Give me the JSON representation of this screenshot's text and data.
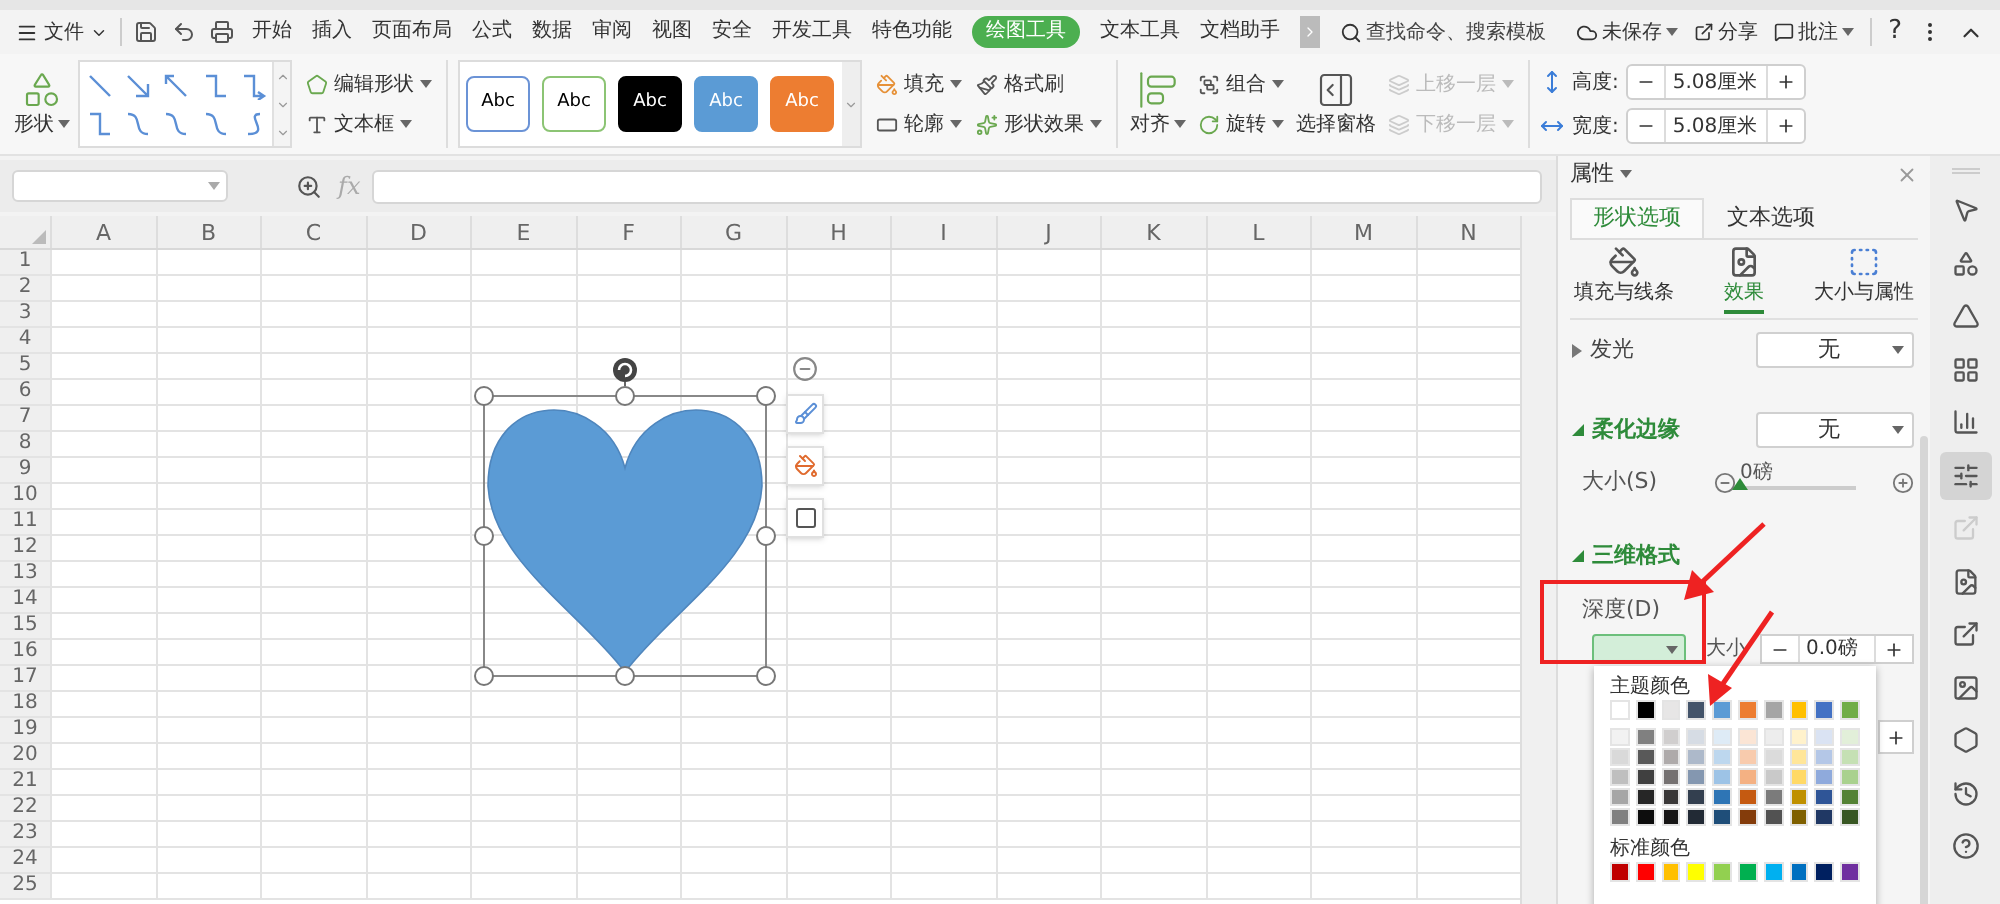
{
  "menu": {
    "file_label": "文件",
    "tabs": [
      {
        "label": "开始",
        "selected": false
      },
      {
        "label": "插入",
        "selected": false
      },
      {
        "label": "页面布局",
        "selected": false
      },
      {
        "label": "公式",
        "selected": false
      },
      {
        "label": "数据",
        "selected": false
      },
      {
        "label": "审阅",
        "selected": false
      },
      {
        "label": "视图",
        "selected": false
      },
      {
        "label": "安全",
        "selected": false
      },
      {
        "label": "开发工具",
        "selected": false
      },
      {
        "label": "特色功能",
        "selected": false
      },
      {
        "label": "绘图工具",
        "selected": true
      },
      {
        "label": "文本工具",
        "selected": false
      },
      {
        "label": "文档助手",
        "selected": false
      }
    ],
    "search": {
      "placeholder": "查找命令、搜索模板"
    },
    "save_status": "未保存",
    "share": "分享",
    "comment": "批注",
    "help": "?"
  },
  "ribbon": {
    "shape": "形状",
    "edit_shape": "编辑形状",
    "text_box": "文本框",
    "styles": [
      {
        "label": "Abc",
        "kind": "outline",
        "color": "#6b93d6"
      },
      {
        "label": "Abc",
        "kind": "outline",
        "color": "#8cc474"
      },
      {
        "label": "Abc",
        "kind": "filled",
        "color": "#000000"
      },
      {
        "label": "Abc",
        "kind": "filled",
        "color": "#5b9bd5"
      },
      {
        "label": "Abc",
        "kind": "filled",
        "color": "#ed7d31"
      }
    ],
    "fill": "填充",
    "outline": "轮廓",
    "format_painter": "格式刷",
    "shape_effects": "形状效果",
    "align": "对齐",
    "group": "组合",
    "rotate": "旋转",
    "selection_pane": "选择窗格",
    "bring_forward": {
      "label": "上移一层",
      "disabled": true
    },
    "send_backward": {
      "label": "下移一层",
      "disabled": true
    },
    "size_fields": [
      {
        "label": "高度:",
        "value": "5.08厘米"
      },
      {
        "label": "宽度:",
        "value": "5.08厘米"
      }
    ]
  },
  "formula_bar": {
    "fx": "fx"
  },
  "sheet": {
    "columns": [
      "A",
      "B",
      "C",
      "D",
      "E",
      "F",
      "G",
      "H",
      "I",
      "J",
      "K",
      "L",
      "M",
      "N"
    ],
    "rows": [
      "1",
      "2",
      "3",
      "4",
      "5",
      "6",
      "7",
      "8",
      "9",
      "10",
      "11",
      "12",
      "13",
      "14",
      "15",
      "16",
      "17",
      "18",
      "19",
      "20",
      "21",
      "22",
      "23",
      "24",
      "25"
    ],
    "shape": {
      "color": "#5b9bd5"
    }
  },
  "props": {
    "title": "属性",
    "tabs": [
      {
        "label": "形状选项",
        "selected": true
      },
      {
        "label": "文本选项",
        "selected": false
      }
    ],
    "subtabs": [
      {
        "label": "填充与线条",
        "selected": false
      },
      {
        "label": "效果",
        "selected": true
      },
      {
        "label": "大小与属性",
        "selected": false
      }
    ],
    "sections": [
      {
        "kind": "dropdown",
        "title": "发光",
        "expanded": false,
        "value": "无"
      },
      {
        "kind": "slider",
        "title": "柔化边缘",
        "expanded": true,
        "value": "无",
        "slider": {
          "label": "大小(S)",
          "reading": "0磅",
          "level": 0
        }
      },
      {
        "kind": "three_d",
        "title": "三维格式",
        "expanded": true,
        "depth_label": "深度(D)",
        "size_label": "大小",
        "size_value": "0.0磅"
      }
    ],
    "palette": {
      "theme_title": "主题颜色",
      "standard_title": "标准颜色",
      "theme_rows": [
        {
          "swatches": [
            {
              "color": "#ffffff"
            },
            {
              "color": "#000000"
            },
            {
              "color": "#e7e6e6"
            },
            {
              "color": "#44546a"
            },
            {
              "color": "#5b9bd5"
            },
            {
              "color": "#ed7d31"
            },
            {
              "color": "#a5a5a5"
            },
            {
              "color": "#ffc000"
            },
            {
              "color": "#4472c4"
            },
            {
              "color": "#70ad47"
            }
          ]
        },
        {
          "swatches": [
            {
              "color": "#f2f2f2"
            },
            {
              "color": "#808080"
            },
            {
              "color": "#d0cece"
            },
            {
              "color": "#d6dce4"
            },
            {
              "color": "#deebf6"
            },
            {
              "color": "#fbe5d5"
            },
            {
              "color": "#ededed"
            },
            {
              "color": "#fff2cc"
            },
            {
              "color": "#dae3f3"
            },
            {
              "color": "#e2efd9"
            }
          ]
        },
        {
          "swatches": [
            {
              "color": "#d9d9d9"
            },
            {
              "color": "#595959"
            },
            {
              "color": "#aeaaaa"
            },
            {
              "color": "#adb9ca"
            },
            {
              "color": "#bdd7ee"
            },
            {
              "color": "#f8cbad"
            },
            {
              "color": "#dbdbdb"
            },
            {
              "color": "#ffe699"
            },
            {
              "color": "#b4c7e7"
            },
            {
              "color": "#c5e0b4"
            }
          ]
        },
        {
          "swatches": [
            {
              "color": "#bfbfbf"
            },
            {
              "color": "#404040"
            },
            {
              "color": "#757171"
            },
            {
              "color": "#8497b0"
            },
            {
              "color": "#9dc3e6"
            },
            {
              "color": "#f4b183"
            },
            {
              "color": "#c9c9c9"
            },
            {
              "color": "#ffd966"
            },
            {
              "color": "#8faadc"
            },
            {
              "color": "#a9d18e"
            }
          ]
        },
        {
          "swatches": [
            {
              "color": "#a6a6a6"
            },
            {
              "color": "#262626"
            },
            {
              "color": "#3a3838"
            },
            {
              "color": "#333f4f"
            },
            {
              "color": "#2e75b5"
            },
            {
              "color": "#c55a11"
            },
            {
              "color": "#7b7b7b"
            },
            {
              "color": "#bf9000"
            },
            {
              "color": "#2f5597"
            },
            {
              "color": "#548235"
            }
          ]
        },
        {
          "swatches": [
            {
              "color": "#808080"
            },
            {
              "color": "#0d0d0d"
            },
            {
              "color": "#171616"
            },
            {
              "color": "#222a35"
            },
            {
              "color": "#1f4e79"
            },
            {
              "color": "#843c0b"
            },
            {
              "color": "#525252"
            },
            {
              "color": "#7f6000"
            },
            {
              "color": "#203864"
            },
            {
              "color": "#385723"
            }
          ]
        }
      ],
      "standard": [
        {
          "color": "#c00000"
        },
        {
          "color": "#ff0000"
        },
        {
          "color": "#ffc000"
        },
        {
          "color": "#ffff00"
        },
        {
          "color": "#92d050"
        },
        {
          "color": "#00b050"
        },
        {
          "color": "#00b0f0"
        },
        {
          "color": "#0070c0"
        },
        {
          "color": "#002060"
        },
        {
          "color": "#7030a0"
        }
      ]
    }
  }
}
